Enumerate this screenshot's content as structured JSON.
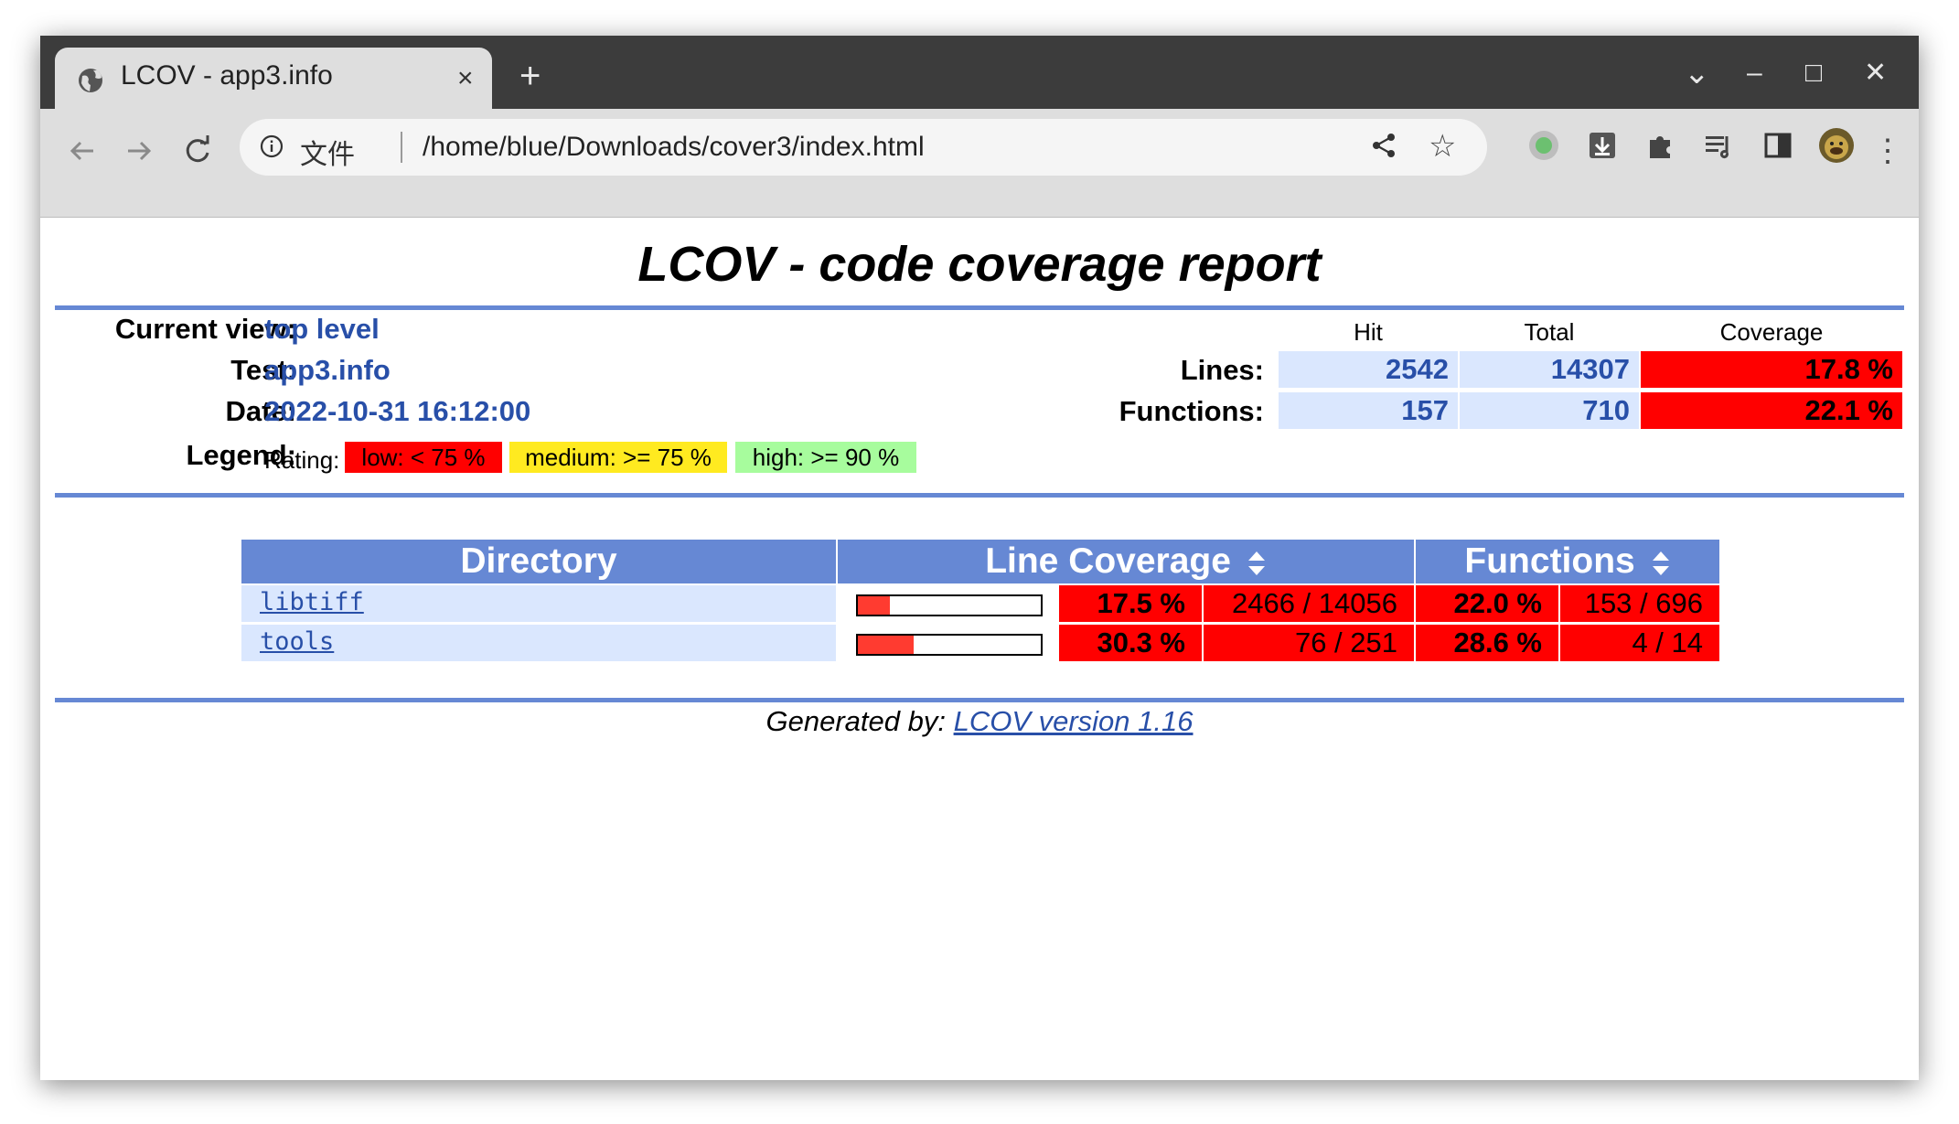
{
  "browser": {
    "tab_title": "LCOV - app3.info",
    "tab_close": "×",
    "new_tab": "+",
    "omnibox_label": "文件",
    "url": "/home/blue/Downloads/cover3/index.html",
    "controls": {
      "dropdown": "⌄",
      "minimize": "–",
      "maximize": "□",
      "close": "✕"
    }
  },
  "report": {
    "title": "LCOV - code coverage report",
    "header": {
      "current_view_label": "Current view:",
      "current_view": "top level",
      "test_label": "Test:",
      "test": "app3.info",
      "date_label": "Date:",
      "date": "2022-10-31 16:12:00",
      "legend_label": "Legend:",
      "rating_label": "Rating:",
      "legend": {
        "low": "low: < 75 %",
        "medium": "medium: >= 75 %",
        "high": "high: >= 90 %"
      }
    },
    "summary": {
      "columns": {
        "hit": "Hit",
        "total": "Total",
        "coverage": "Coverage"
      },
      "lines": {
        "label": "Lines:",
        "hit": "2542",
        "total": "14307",
        "coverage": "17.8 %"
      },
      "functions": {
        "label": "Functions:",
        "hit": "157",
        "total": "710",
        "coverage": "22.1 %"
      }
    },
    "table": {
      "headers": {
        "directory": "Directory",
        "line_coverage": "Line Coverage",
        "functions": "Functions"
      },
      "rows": [
        {
          "name": "libtiff",
          "line_pct": "17.5 %",
          "line_ratio": "2466 / 14056",
          "line_fraction": 0.175,
          "func_pct": "22.0 %",
          "func_ratio": "153 / 696"
        },
        {
          "name": "tools",
          "line_pct": "30.3 %",
          "line_ratio": "76 / 251",
          "line_fraction": 0.303,
          "func_pct": "28.6 %",
          "func_ratio": "4 / 14"
        }
      ]
    },
    "footer": {
      "prefix": "Generated by: ",
      "link": "LCOV version 1.16"
    }
  },
  "colors": {
    "accent": "#6688d4",
    "low": "#ff0000",
    "medium": "#ffea20",
    "high": "#a7fc9d",
    "cell_blue": "#dae7fe",
    "link": "#284fa8"
  }
}
